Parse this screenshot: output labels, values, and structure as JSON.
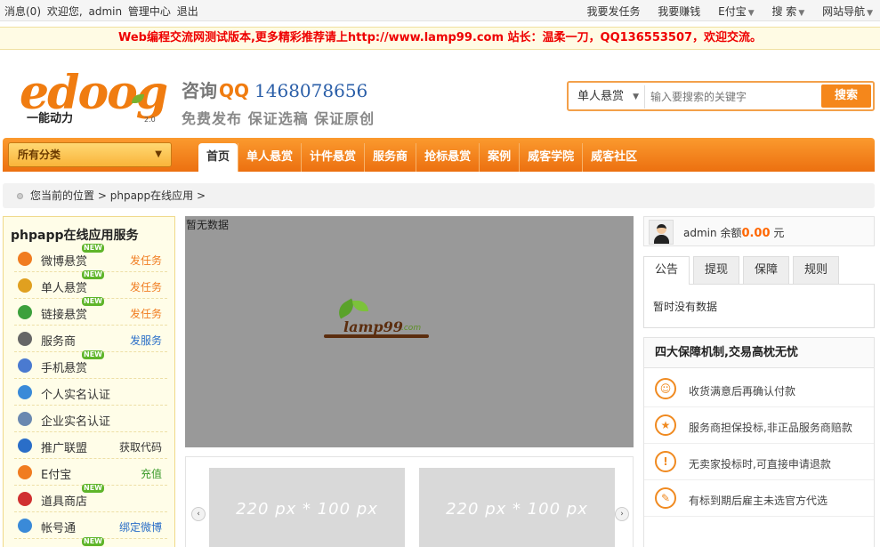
{
  "topbar": {
    "messages": "消息(0)",
    "welcome": "欢迎您,",
    "user": "admin",
    "admin_center": "管理中心",
    "logout": "退出",
    "links": [
      "我要发任务",
      "我要赚钱",
      "E付宝",
      "搜 索",
      "网站导航"
    ]
  },
  "notice": "Web编程交流网测试版本,更多精彩推荐请上http://www.lamp99.com 站长：温柔一刀，QQ136553507，欢迎交流。",
  "header": {
    "logo_text": "edoog",
    "logo_sub": "一能动力",
    "logo_version": "2.0",
    "consult_label": "咨询",
    "consult_qq": "QQ",
    "consult_phone": "1468078656",
    "slogan": "免费发布 保证选稿 保证原创"
  },
  "search": {
    "type_selected": "单人悬赏",
    "placeholder": "输入要搜索的关键字",
    "button": "搜索"
  },
  "nav": {
    "category": "所有分类",
    "items": [
      "首页",
      "单人悬赏",
      "计件悬赏",
      "服务商",
      "抢标悬赏",
      "案例",
      "威客学院",
      "威客社区"
    ]
  },
  "breadcrumb": {
    "label": "您当前的位置",
    "sep": ">",
    "page": "phpapp在线应用",
    "sep2": ">"
  },
  "sidebar": {
    "title": "phpapp在线应用服务",
    "items": [
      {
        "name": "微博悬赏",
        "action": "发任务",
        "new": "NEW",
        "icon": "weibo-icon",
        "color": "#f07c20",
        "action_color": "#f07c20"
      },
      {
        "name": "单人悬赏",
        "action": "发任务",
        "new": "NEW",
        "icon": "coins-icon",
        "color": "#e0a020",
        "action_color": "#f07c20"
      },
      {
        "name": "链接悬赏",
        "action": "发任务",
        "new": "NEW",
        "icon": "link-icon",
        "color": "#3ca03c",
        "action_color": "#f07c20"
      },
      {
        "name": "服务商",
        "action": "发服务",
        "new": "",
        "icon": "service-icon",
        "color": "#666666",
        "action_color": "#2a6ec8"
      },
      {
        "name": "手机悬赏",
        "action": "",
        "new": "NEW",
        "icon": "phone-icon",
        "color": "#4a7ad0",
        "action_color": "#333333"
      },
      {
        "name": "个人实名认证",
        "action": "",
        "new": "",
        "icon": "person-icon",
        "color": "#3a8ad8",
        "action_color": "#333333"
      },
      {
        "name": "企业实名认证",
        "action": "",
        "new": "",
        "icon": "building-icon",
        "color": "#6a88b0",
        "action_color": "#333333"
      },
      {
        "name": "推广联盟",
        "action": "获取代码",
        "new": "",
        "icon": "speaker-icon",
        "color": "#2a6ec8",
        "action_color": "#333333"
      },
      {
        "name": "E付宝",
        "action": "充值",
        "new": "",
        "icon": "epay-icon",
        "color": "#f07c20",
        "action_color": "#3a9a2a"
      },
      {
        "name": "道具商店",
        "action": "",
        "new": "NEW",
        "icon": "shop-icon",
        "color": "#d03030",
        "action_color": "#333333"
      },
      {
        "name": "帐号通",
        "action": "绑定微博",
        "new": "",
        "icon": "account-icon",
        "color": "#3a8ad8",
        "action_color": "#2a6ec8"
      },
      {
        "name": "",
        "action": "",
        "new": "NEW",
        "icon": "",
        "color": "#ffffff",
        "action_color": "#333333"
      }
    ]
  },
  "banner": {
    "nodata": "暂无数据",
    "logo_text": "lamp99",
    "logo_domain": ".com"
  },
  "carousel": {
    "slides": [
      "220 px * 100 px",
      "220 px * 100 px"
    ],
    "prev": "‹",
    "next": "›"
  },
  "userbox": {
    "username": "admin",
    "balance_label": "余额",
    "balance": "0.00",
    "unit": "元"
  },
  "tabs": {
    "items": [
      "公告",
      "提现",
      "保障",
      "规则"
    ],
    "content": "暂时没有数据"
  },
  "guarantee": {
    "title": "四大保障机制,交易高枕无忧",
    "items": [
      {
        "text": "收货满意后再确认付款",
        "icon": "smile-icon",
        "glyph": "☺"
      },
      {
        "text": "服务商担保投标,非正品服务商赔款",
        "icon": "star-icon",
        "glyph": "★"
      },
      {
        "text": "无卖家投标时,可直接申请退款",
        "icon": "alert-icon",
        "glyph": "!"
      },
      {
        "text": "有标到期后雇主未选官方代选",
        "icon": "document-icon",
        "glyph": "✎"
      }
    ]
  }
}
